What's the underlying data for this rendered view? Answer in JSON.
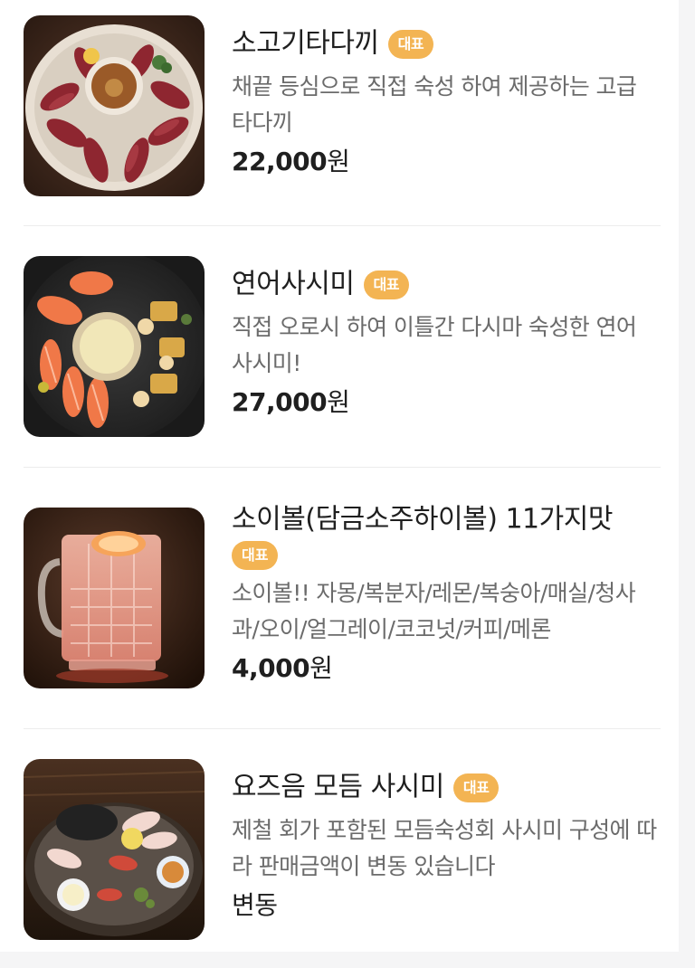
{
  "menu": {
    "items": [
      {
        "name": "소고기타다끼",
        "badge": "대표",
        "description": "채끝 등심으로 직접 숙성 하여 제공하는 고급 타다끼",
        "price": "22,000",
        "price_unit": "원"
      },
      {
        "name": "연어사시미",
        "badge": "대표",
        "description": "직접 오로시 하여 이틀간 다시마 숙성한 연어 사시미!",
        "price": "27,000",
        "price_unit": "원"
      },
      {
        "name": "소이볼(담금소주하이볼) 11가지맛",
        "badge": "대표",
        "description": "소이볼!! 자몽/복분자/레몬/복숭아/매실/청사과/오이/얼그레이/코코넛/커피/메론",
        "price": "4,000",
        "price_unit": "원"
      },
      {
        "name": "요즈음 모듬 사시미",
        "badge": "대표",
        "description": "제철 회가 포함된 모듬숙성회 사시미 구성에 따라 판매금액이 변동 있습니다",
        "price": "변동",
        "price_unit": ""
      }
    ]
  },
  "colors": {
    "badge": "#f3b453",
    "title": "#1f1f1f",
    "description": "#6b6b6b",
    "divider": "#ececec"
  }
}
